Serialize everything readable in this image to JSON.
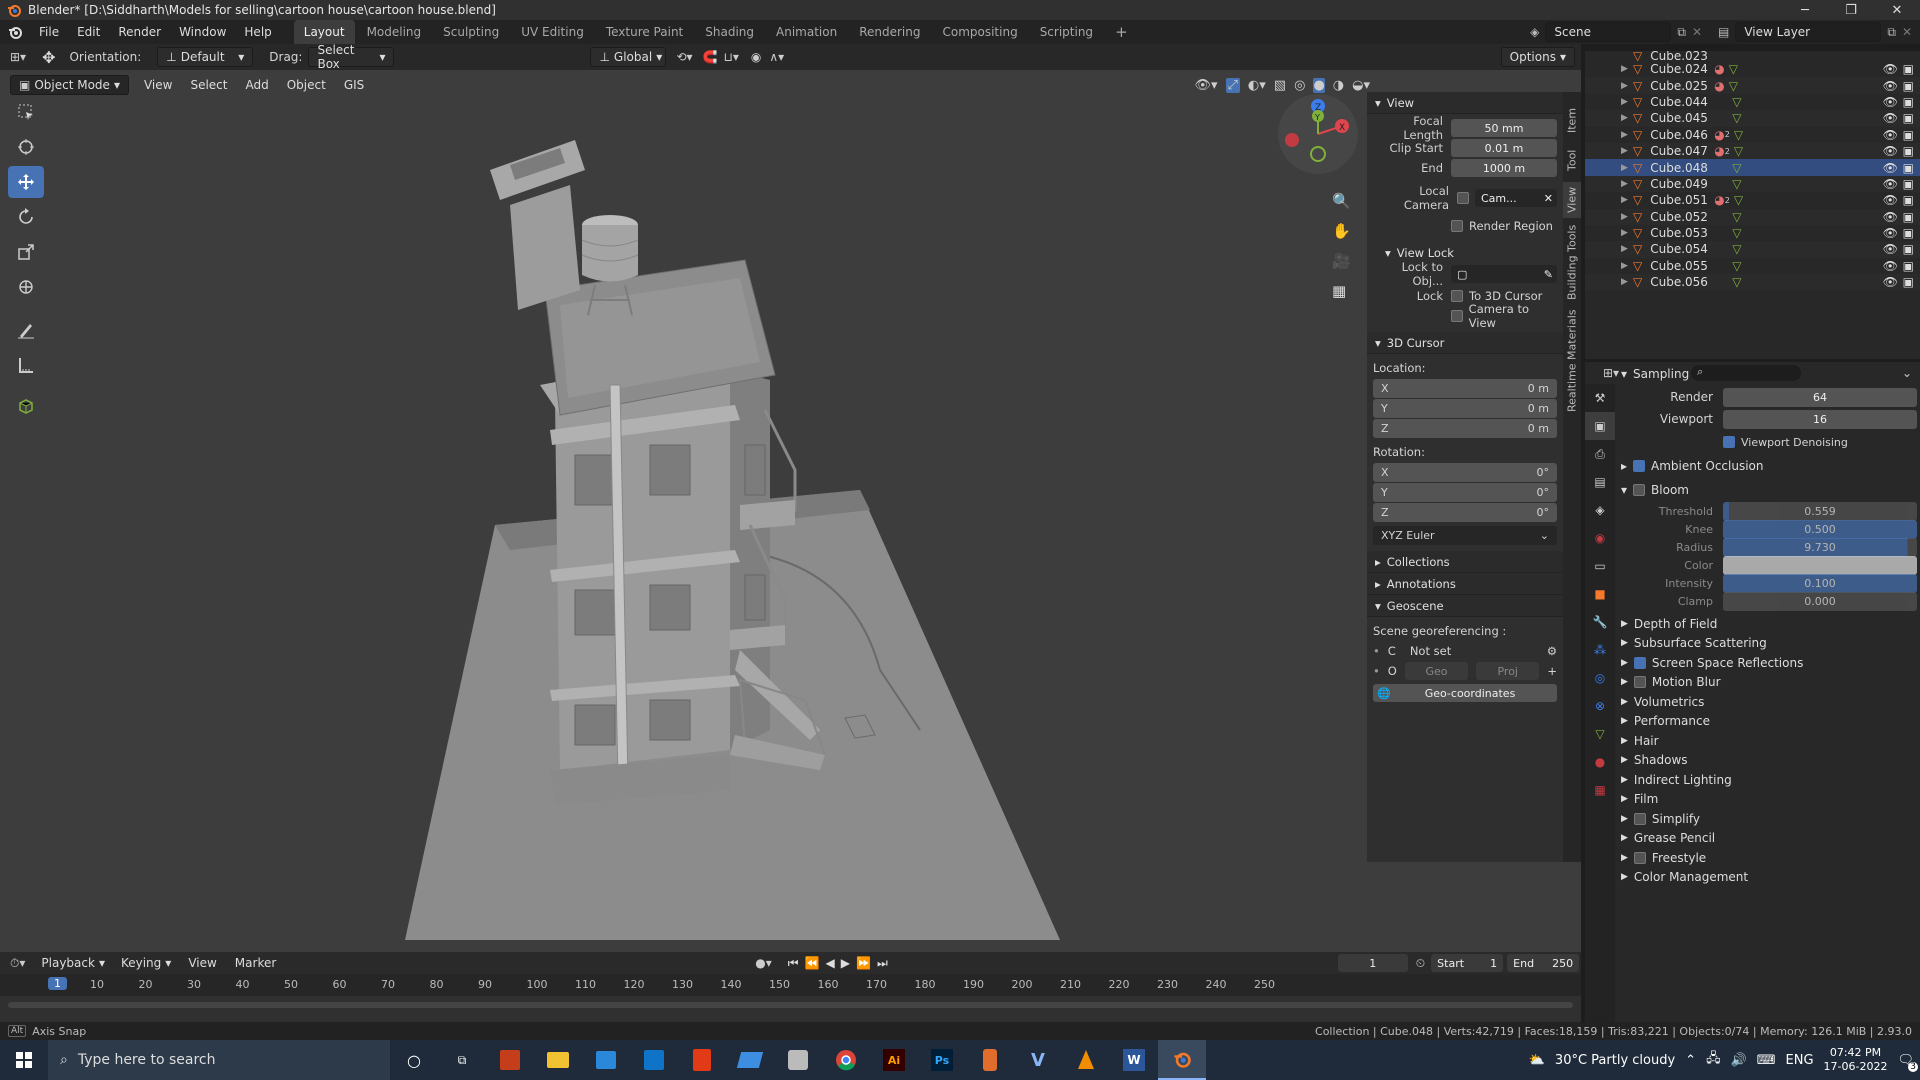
{
  "title_bar": {
    "title": "Blender* [D:\\Siddharth\\Models for selling\\cartoon house\\cartoon house.blend]",
    "min": "─",
    "max": "❐",
    "close": "✕"
  },
  "menus": [
    "File",
    "Edit",
    "Render",
    "Window",
    "Help"
  ],
  "workspace_tabs": [
    {
      "label": "Layout",
      "active": true
    },
    {
      "label": "Modeling"
    },
    {
      "label": "Sculpting"
    },
    {
      "label": "UV Editing"
    },
    {
      "label": "Texture Paint"
    },
    {
      "label": "Shading"
    },
    {
      "label": "Animation"
    },
    {
      "label": "Rendering"
    },
    {
      "label": "Compositing"
    },
    {
      "label": "Scripting"
    }
  ],
  "add_workspace": "+",
  "scene_field": "Scene",
  "view_layer_field": "View Layer",
  "tool_header": {
    "orientation_label": "Orientation:",
    "orientation_value": "Default",
    "drag_label": "Drag:",
    "drag_value": "Select Box",
    "transform_orientation": "Global",
    "options": "Options"
  },
  "viewport_header": {
    "mode": "Object Mode",
    "menus": [
      "View",
      "Select",
      "Add",
      "Object",
      "GIS"
    ]
  },
  "npanel": {
    "view_section": "View",
    "focal_length_label": "Focal Length",
    "focal_length": "50 mm",
    "clip_start_label": "Clip Start",
    "clip_start": "0.01 m",
    "end_label": "End",
    "end": "1000 m",
    "local_camera_label": "Local Camera",
    "local_camera_value": "Cam...",
    "render_region": "Render Region",
    "view_lock": "View Lock",
    "lock_to_obj": "Lock to Obj...",
    "lock_label": "Lock",
    "to_3d_cursor": "To 3D Cursor",
    "camera_to_view": "Camera to View",
    "cursor_section": "3D Cursor",
    "location_label": "Location:",
    "location": [
      {
        "axis": "X",
        "value": "0 m"
      },
      {
        "axis": "Y",
        "value": "0 m"
      },
      {
        "axis": "Z",
        "value": "0 m"
      }
    ],
    "rotation_label": "Rotation:",
    "rotation": [
      {
        "axis": "X",
        "value": "0°"
      },
      {
        "axis": "Y",
        "value": "0°"
      },
      {
        "axis": "Z",
        "value": "0°"
      }
    ],
    "rotation_mode": "XYZ Euler",
    "collections": "Collections",
    "annotations": "Annotations",
    "geoscene": "Geoscene",
    "scene_georef": "Scene georeferencing :",
    "crs_c": "C",
    "crs_not_set": "Not set",
    "crs_o": "O",
    "geo_btn": "Geo",
    "proj_btn": "Proj",
    "geo_coordinates": "Geo-coordinates"
  },
  "side_tabs": [
    "Item",
    "Tool",
    "View",
    "Building Tools",
    "Realtime Materials"
  ],
  "outliner": {
    "partial_top": "Cube.023",
    "items": [
      {
        "name": "Cube.024",
        "mat": true
      },
      {
        "name": "Cube.025",
        "mat": true
      },
      {
        "name": "Cube.044",
        "mat": false
      },
      {
        "name": "Cube.045",
        "mat": false
      },
      {
        "name": "Cube.046",
        "mat": true,
        "badge": "2"
      },
      {
        "name": "Cube.047",
        "mat": true,
        "badge": "2"
      },
      {
        "name": "Cube.048",
        "mat": false,
        "selected": true
      },
      {
        "name": "Cube.049",
        "mat": false
      },
      {
        "name": "Cube.051",
        "mat": true,
        "badge": "2"
      },
      {
        "name": "Cube.052",
        "mat": false
      },
      {
        "name": "Cube.053",
        "mat": false
      },
      {
        "name": "Cube.054",
        "mat": false
      },
      {
        "name": "Cube.055",
        "mat": false
      },
      {
        "name": "Cube.056",
        "mat": false
      }
    ]
  },
  "properties": {
    "sampling": "Sampling",
    "render_label": "Render",
    "render_value": "64",
    "viewport_label": "Viewport",
    "viewport_value": "16",
    "viewport_denoising": "Viewport Denoising",
    "ambient_occlusion": "Ambient Occlusion",
    "bloom": "Bloom",
    "bloom_fields": [
      {
        "label": "Threshold",
        "value": "0.559",
        "fill": 0.03
      },
      {
        "label": "Knee",
        "value": "0.500",
        "fill": 1.0
      },
      {
        "label": "Radius",
        "value": "9.730",
        "fill": 0.95
      },
      {
        "label": "Color",
        "value": "",
        "fill": 0,
        "color": "#e0e0e0"
      },
      {
        "label": "Intensity",
        "value": "0.100",
        "fill": 1.0
      },
      {
        "label": "Clamp",
        "value": "0.000",
        "fill": 0
      }
    ],
    "sections": [
      {
        "label": "Depth of Field",
        "check": null
      },
      {
        "label": "Subsurface Scattering",
        "check": null
      },
      {
        "label": "Screen Space Reflections",
        "check": true
      },
      {
        "label": "Motion Blur",
        "check": false
      },
      {
        "label": "Volumetrics",
        "check": null
      },
      {
        "label": "Performance",
        "check": null
      },
      {
        "label": "Hair",
        "check": null
      },
      {
        "label": "Shadows",
        "check": null
      },
      {
        "label": "Indirect Lighting",
        "check": null
      },
      {
        "label": "Film",
        "check": null
      },
      {
        "label": "Simplify",
        "check": false
      },
      {
        "label": "Grease Pencil",
        "check": null
      },
      {
        "label": "Freestyle",
        "check": false
      },
      {
        "label": "Color Management",
        "check": null
      }
    ]
  },
  "timeline": {
    "menus": [
      "Playback",
      "Keying",
      "View",
      "Marker"
    ],
    "current_frame": "1",
    "start_label": "Start",
    "start": "1",
    "end_label": "End",
    "end": "250",
    "ticks": [
      "10",
      "20",
      "30",
      "40",
      "50",
      "60",
      "70",
      "80",
      "90",
      "100",
      "110",
      "120",
      "130",
      "140",
      "150",
      "160",
      "170",
      "180",
      "190",
      "200",
      "210",
      "220",
      "230",
      "240",
      "250"
    ],
    "playhead": "1"
  },
  "status": {
    "alt": "Alt",
    "axis_snap": "Axis Snap",
    "info": "Collection | Cube.048 | Verts:42,719 | Faces:18,159 | Tris:83,221 | Objects:0/74 | Memory: 126.1 MiB | 2.93.0"
  },
  "taskbar": {
    "search_placeholder": "Type here to search",
    "weather": "30°C  Partly cloudy",
    "lang": "ENG",
    "time": "07:42 PM",
    "date": "17-06-2022",
    "notif": "3"
  },
  "colors": {
    "accent": "#4772b3",
    "x_axis": "#e0444d",
    "y_axis": "#7fb13a",
    "z_axis": "#3b7ded"
  }
}
